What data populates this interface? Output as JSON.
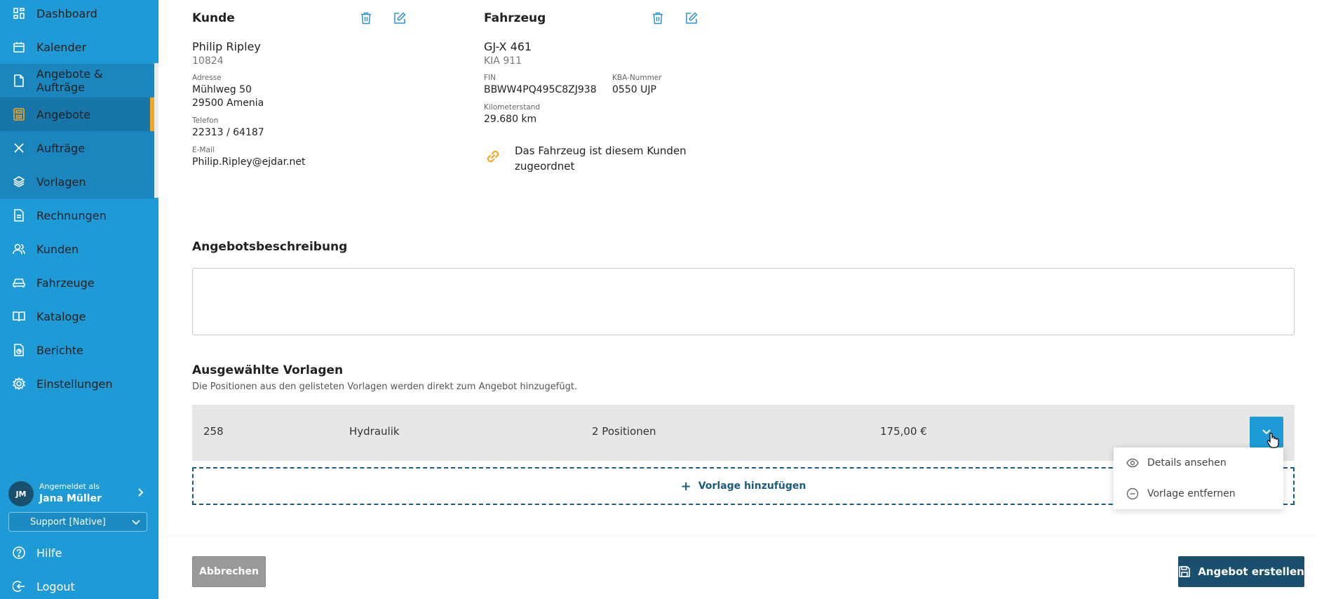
{
  "sidebar": {
    "items": [
      {
        "label": "Dashboard",
        "icon": "dashboard-icon"
      },
      {
        "label": "Kalender",
        "icon": "calendar-icon"
      },
      {
        "label": "Angebote & Aufträge",
        "icon": "document-icon"
      },
      {
        "label": "Angebote",
        "icon": "calculator-icon"
      },
      {
        "label": "Aufträge",
        "icon": "tools-icon"
      },
      {
        "label": "Vorlagen",
        "icon": "layers-icon"
      },
      {
        "label": "Rechnungen",
        "icon": "invoice-icon"
      },
      {
        "label": "Kunden",
        "icon": "users-icon"
      },
      {
        "label": "Fahrzeuge",
        "icon": "car-icon"
      },
      {
        "label": "Kataloge",
        "icon": "book-icon"
      },
      {
        "label": "Berichte",
        "icon": "report-icon"
      },
      {
        "label": "Einstellungen",
        "icon": "gear-icon"
      }
    ],
    "user": {
      "initials": "JM",
      "label": "Angemeldet als",
      "name": "Jana Müller"
    },
    "support_select": "Support [Native]",
    "help_label": "Hilfe",
    "logout_label": "Logout",
    "colors": {
      "bg": "#1e9ad6",
      "active": "#1775a8",
      "accent": "#f5a623"
    }
  },
  "customer": {
    "title": "Kunde",
    "name": "Philip Ripley",
    "number": "10824",
    "address_label": "Adresse",
    "street": "Mühlweg 50",
    "city": "29500 Amenia",
    "phone_label": "Telefon",
    "phone": "22313 / 64187",
    "email_label": "E-Mail",
    "email": "Philip.Ripley@ejdar.net"
  },
  "vehicle": {
    "title": "Fahrzeug",
    "plate": "GJ-X 461",
    "model": "KIA 911",
    "fin_label": "FIN",
    "fin": "BBWW4PQ495C8ZJ938",
    "kba_label": "KBA-Nummer",
    "kba": "0550 UJP",
    "mileage_label": "Kilometerstand",
    "mileage": "29.680 km",
    "link_line1": "Das Fahrzeug ist diesem Kunden",
    "link_line2": "zugeordnet"
  },
  "description": {
    "title": "Angebotsbeschreibung",
    "value": ""
  },
  "templates": {
    "title": "Ausgewählte Vorlagen",
    "subtitle": "Die Positionen aus den gelisteten Vorlagen werden direkt zum Angebot hinzugefügt.",
    "rows": [
      {
        "number": "258",
        "name": "Hydraulik",
        "positions": "2 Positionen",
        "price": "175,00 €"
      }
    ],
    "add_label": "Vorlage hinzufügen",
    "dropdown": {
      "details_label": "Details ansehen",
      "remove_label": "Vorlage entfernen"
    }
  },
  "footer": {
    "cancel_label": "Abbrechen",
    "create_label": "Angebot erstellen"
  }
}
